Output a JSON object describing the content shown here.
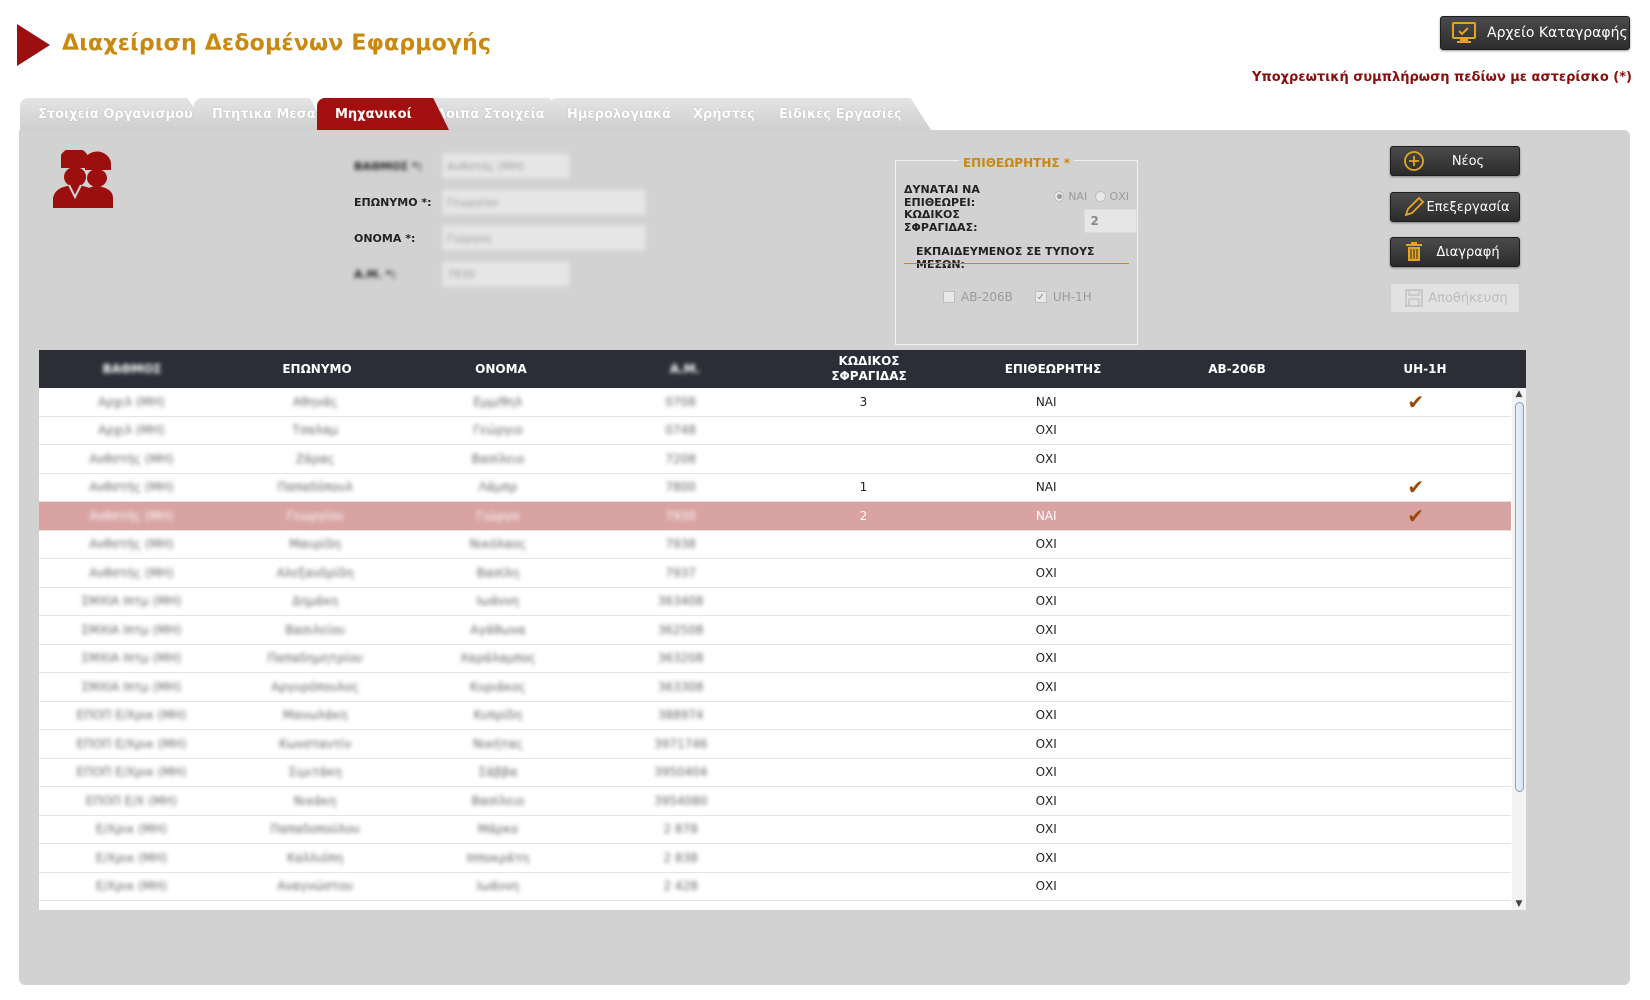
{
  "header": {
    "title": "Διαχείριση Δεδομένων Εφαρμογής",
    "log_button": "Αρχείο Καταγραφής",
    "required_note": "Υποχρεωτική συμπλήρωση πεδίων με αστερίσκο (*)"
  },
  "tabs": [
    {
      "label": "Στοιχεία Οργανισμού",
      "active": false
    },
    {
      "label": "Πτητικά Μέσα",
      "active": false
    },
    {
      "label": "Μηχανικοί",
      "active": true
    },
    {
      "label": "Λοιπά Στοιχεία",
      "active": false
    },
    {
      "label": "Ημερολογιακά",
      "active": false
    },
    {
      "label": "Χρήστες",
      "active": false
    },
    {
      "label": "Ειδικές Εργασίες",
      "active": false
    }
  ],
  "form": {
    "rank_label": "ΒΑΘΜΟΣ *:",
    "rank_value": "Ανθστής (ΜΗ)",
    "surname_label": "ΕΠΩΝΥΜΟ *:",
    "surname_value": "Γεωργίου",
    "name_label": "ΟΝΟΜΑ *:",
    "name_value": "Γιώργος",
    "am_label": "Α.Μ. *:",
    "am_value": "7930"
  },
  "inspector": {
    "title": "ΕΠΙΘΕΩΡΗΤΗΣ *",
    "can_inspect_label": "ΔΥΝΑΤΑΙ ΝΑ ΕΠΙΘΕΩΡΕΙ:",
    "yes": "ΝΑΙ",
    "no": "ΟΧΙ",
    "selected": "ΝΑΙ",
    "seal_label": "ΚΩΔΙΚΟΣ ΣΦΡΑΓΙΔΑΣ:",
    "seal_value": "2",
    "trained_label": "ΕΚΠΑΙΔΕΥΜΕΝΟΣ ΣΕ ΤΥΠΟΥΣ ΜΕΣΩΝ:",
    "types": [
      {
        "label": "AB-206B",
        "checked": false
      },
      {
        "label": "UH-1H",
        "checked": true
      }
    ]
  },
  "actions": {
    "new": "Νέος",
    "edit": "Επεξεργασία",
    "delete": "Διαγραφή",
    "save": "Αποθήκευση"
  },
  "icons": {
    "header_arrow": "play-triangle-icon",
    "log": "monitor-check-icon",
    "worker": "workers-helmet-icon",
    "new": "plus-circle-icon",
    "edit": "pencil-icon",
    "delete": "trash-icon",
    "save": "floppy-disk-icon"
  },
  "colors": {
    "accent": "#a30e0e",
    "gold": "#c8890e",
    "selected_row": "#d9a3a4",
    "header_dark": "#2b2e37"
  },
  "table": {
    "columns": [
      "ΒΑΘΜΟΣ",
      "ΕΠΩΝΥΜΟ",
      "ΟΝΟΜΑ",
      "Α.Μ.",
      "ΚΩΔΙΚΟΣ ΣΦΡΑΓΙΔΑΣ",
      "ΕΠΙΘΕΩΡΗΤΗΣ",
      "AB-206B",
      "UH-1H"
    ],
    "rows": [
      {
        "rank": "Αρχιλ (ΜΗ)",
        "surname": "Αθηνάς",
        "name": "Εμμ/θηλ",
        "am": "0708",
        "seal": "3",
        "inspector": "ΝΑΙ",
        "ab206": "",
        "uh1h": "✔",
        "selected": false
      },
      {
        "rank": "Αρχιλ (ΜΗ)",
        "surname": "Τσαλαμ",
        "name": "Γεώργιο",
        "am": "0748",
        "seal": "",
        "inspector": "ΟΧΙ",
        "ab206": "",
        "uh1h": "",
        "selected": false
      },
      {
        "rank": "Ανθστής (ΜΗ)",
        "surname": "Ζάρας",
        "name": "Βασίλειο",
        "am": "7208",
        "seal": "",
        "inspector": "ΟΧΙ",
        "ab206": "",
        "uh1h": "",
        "selected": false
      },
      {
        "rank": "Ανθστής (ΜΗ)",
        "surname": "Παπαδόπουλ",
        "name": "Λάμπρ",
        "am": "7800",
        "seal": "1",
        "inspector": "ΝΑΙ",
        "ab206": "",
        "uh1h": "✔",
        "selected": false
      },
      {
        "rank": "Ανθστής (ΜΗ)",
        "surname": "Γεωργίου",
        "name": "Γιώργο",
        "am": "7930",
        "seal": "2",
        "inspector": "ΝΑΙ",
        "ab206": "",
        "uh1h": "✔",
        "selected": true
      },
      {
        "rank": "Ανθστής (ΜΗ)",
        "surname": "Μαυρίδη",
        "name": "Νικόλαος",
        "am": "7938",
        "seal": "",
        "inspector": "ΟΧΙ",
        "ab206": "",
        "uh1h": "",
        "selected": false
      },
      {
        "rank": "Ανθστής (ΜΗ)",
        "surname": "Αλεξανδρίδη",
        "name": "Βασίλη",
        "am": "7937",
        "seal": "",
        "inspector": "ΟΧΙ",
        "ab206": "",
        "uh1h": "",
        "selected": false
      },
      {
        "rank": "ΣΜΧΙΑ Ιπτμ (ΜΗ)",
        "surname": "Δημάκη",
        "name": "Ιωάννη",
        "am": "363408",
        "seal": "",
        "inspector": "ΟΧΙ",
        "ab206": "",
        "uh1h": "",
        "selected": false
      },
      {
        "rank": "ΣΜΧΙΑ Ιπτμ (ΜΗ)",
        "surname": "Βασιλείου",
        "name": "Αγάθωνα",
        "am": "362508",
        "seal": "",
        "inspector": "ΟΧΙ",
        "ab206": "",
        "uh1h": "",
        "selected": false
      },
      {
        "rank": "ΣΜΧΙΑ Ιπτμ (ΜΗ)",
        "surname": "Παπαδημητρίου",
        "name": "Χαράλαμπος",
        "am": "363208",
        "seal": "",
        "inspector": "ΟΧΙ",
        "ab206": "",
        "uh1h": "",
        "selected": false
      },
      {
        "rank": "ΣΜΧΙΑ Ιπτμ (ΜΗ)",
        "surname": "Αργυρόπουλος",
        "name": "Κυριάκος",
        "am": "363308",
        "seal": "",
        "inspector": "ΟΧΙ",
        "ab206": "",
        "uh1h": "",
        "selected": false
      },
      {
        "rank": "ΕΠΟΠ Ε/Χρικ (ΜΗ)",
        "surname": "Μανωλάκη",
        "name": "Κυπρίδη",
        "am": "388974",
        "seal": "",
        "inspector": "ΟΧΙ",
        "ab206": "",
        "uh1h": "",
        "selected": false
      },
      {
        "rank": "ΕΠΟΠ Ε/Χρικ (ΜΗ)",
        "surname": "Κωνσταντίν",
        "name": "Νικήτας",
        "am": "3971746",
        "seal": "",
        "inspector": "ΟΧΙ",
        "ab206": "",
        "uh1h": "",
        "selected": false
      },
      {
        "rank": "ΕΠΟΠ Ε/Χρικ (ΜΗ)",
        "surname": "Σιμιτάκη",
        "name": "Σάββα",
        "am": "3950404",
        "seal": "",
        "inspector": "ΟΧΙ",
        "ab206": "",
        "uh1h": "",
        "selected": false
      },
      {
        "rank": "ΕΠΟΠ Ε/Χ (ΜΗ)",
        "surname": "Νικάκη",
        "name": "Βασίλειο",
        "am": "3954080",
        "seal": "",
        "inspector": "ΟΧΙ",
        "ab206": "",
        "uh1h": "",
        "selected": false
      },
      {
        "rank": "Ε/Χρικ (ΜΗ)",
        "surname": "Παπαδοπούλου",
        "name": "Μάρκο",
        "am": "2 878",
        "seal": "",
        "inspector": "ΟΧΙ",
        "ab206": "",
        "uh1h": "",
        "selected": false
      },
      {
        "rank": "Ε/Χρικ (ΜΗ)",
        "surname": "Καλλιόπη",
        "name": "Ιπποκράτη",
        "am": "2 838",
        "seal": "",
        "inspector": "ΟΧΙ",
        "ab206": "",
        "uh1h": "",
        "selected": false
      },
      {
        "rank": "Ε/Χρικ (ΜΗ)",
        "surname": "Αναγνώστου",
        "name": "Ιωάννη",
        "am": "2 428",
        "seal": "",
        "inspector": "ΟΧΙ",
        "ab206": "",
        "uh1h": "",
        "selected": false
      }
    ]
  }
}
